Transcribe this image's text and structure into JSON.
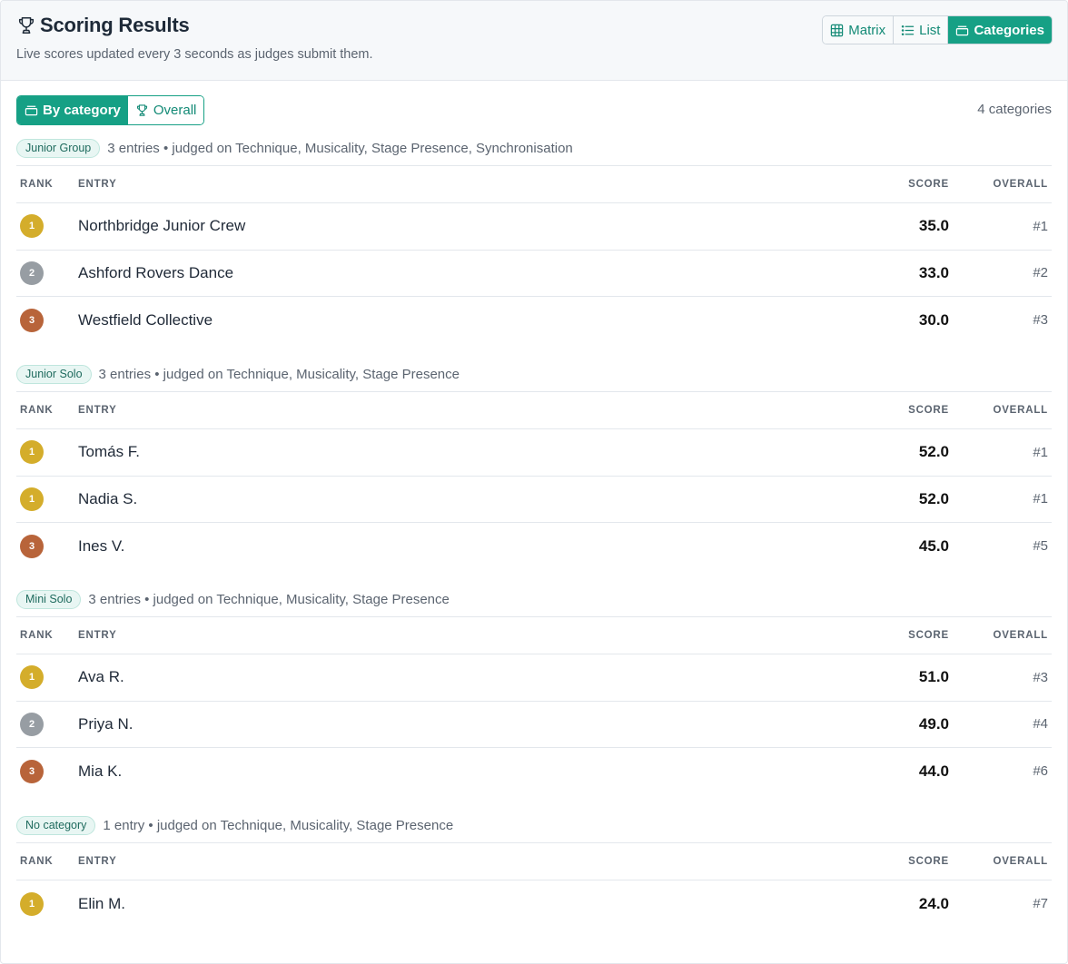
{
  "header": {
    "title": "Scoring Results",
    "subtitle": "Live scores updated every 3 seconds as judges submit them.",
    "views": [
      {
        "label": "Matrix",
        "icon": "grid-icon",
        "active": false
      },
      {
        "label": "List",
        "icon": "list-icon",
        "active": false
      },
      {
        "label": "Categories",
        "icon": "folder-icon",
        "active": true
      }
    ]
  },
  "toolbar": {
    "modes": [
      {
        "label": "By category",
        "icon": "folder-icon",
        "active": true
      },
      {
        "label": "Overall",
        "icon": "trophy-icon",
        "active": false
      }
    ],
    "count": "4 categories"
  },
  "columns": {
    "rank": "RANK",
    "entry": "ENTRY",
    "score": "SCORE",
    "overall": "OVERALL"
  },
  "colors": {
    "accent": "#16a085",
    "gold": "#d4ad2b",
    "silver": "#979da3",
    "bronze": "#b8643a"
  },
  "categories": [
    {
      "name": "Junior Group",
      "desc": "3 entries • judged on Technique, Musicality, Stage Presence, Synchronisation",
      "rows": [
        {
          "rank": "1",
          "medal": "gold",
          "entry": "Northbridge Junior Crew",
          "score": "35.0",
          "overall": "#1"
        },
        {
          "rank": "2",
          "medal": "silver",
          "entry": "Ashford Rovers Dance",
          "score": "33.0",
          "overall": "#2"
        },
        {
          "rank": "3",
          "medal": "bronze",
          "entry": "Westfield Collective",
          "score": "30.0",
          "overall": "#3"
        }
      ]
    },
    {
      "name": "Junior Solo",
      "desc": "3 entries • judged on Technique, Musicality, Stage Presence",
      "rows": [
        {
          "rank": "1",
          "medal": "gold",
          "entry": "Tomás F.",
          "score": "52.0",
          "overall": "#1"
        },
        {
          "rank": "1",
          "medal": "gold",
          "entry": "Nadia S.",
          "score": "52.0",
          "overall": "#1"
        },
        {
          "rank": "3",
          "medal": "bronze",
          "entry": "Ines V.",
          "score": "45.0",
          "overall": "#5"
        }
      ]
    },
    {
      "name": "Mini Solo",
      "desc": "3 entries • judged on Technique, Musicality, Stage Presence",
      "rows": [
        {
          "rank": "1",
          "medal": "gold",
          "entry": "Ava R.",
          "score": "51.0",
          "overall": "#3"
        },
        {
          "rank": "2",
          "medal": "silver",
          "entry": "Priya N.",
          "score": "49.0",
          "overall": "#4"
        },
        {
          "rank": "3",
          "medal": "bronze",
          "entry": "Mia K.",
          "score": "44.0",
          "overall": "#6"
        }
      ]
    },
    {
      "name": "No category",
      "desc": "1 entry • judged on Technique, Musicality, Stage Presence",
      "rows": [
        {
          "rank": "1",
          "medal": "gold",
          "entry": "Elin M.",
          "score": "24.0",
          "overall": "#7"
        }
      ]
    }
  ]
}
